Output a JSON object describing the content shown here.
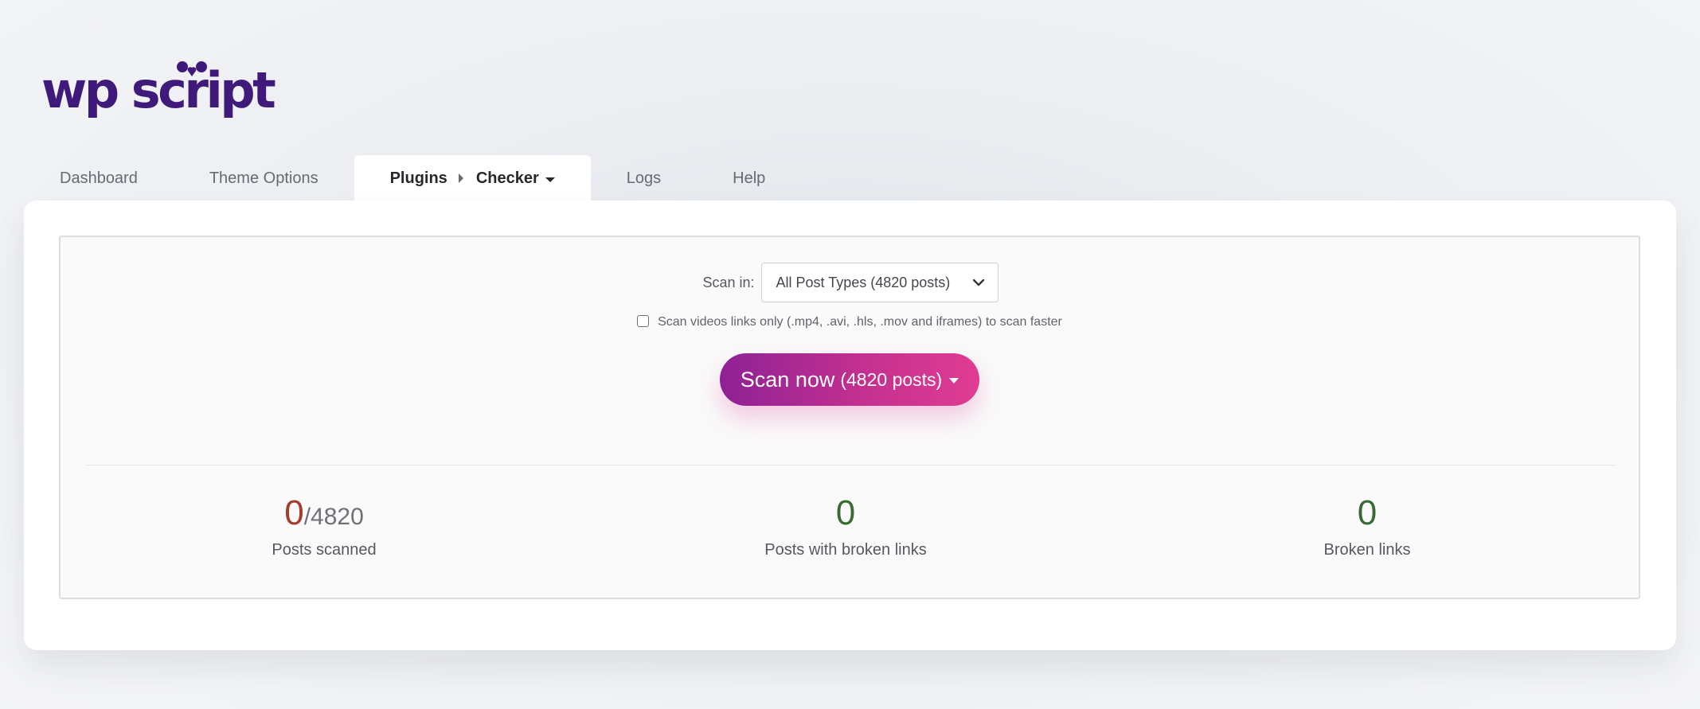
{
  "logo": {
    "text": "wp script"
  },
  "tabs": [
    {
      "label": "Dashboard"
    },
    {
      "label": "Theme Options"
    },
    {
      "label": "Plugins",
      "sub_label": "Checker",
      "active": true
    },
    {
      "label": "Logs"
    },
    {
      "label": "Help"
    }
  ],
  "scan": {
    "label": "Scan in:",
    "select_value": "All Post Types (4820 posts)",
    "checkbox_label": "Scan videos links only (.mp4, .avi, .hls, .mov and iframes) to scan faster",
    "checkbox_checked": false,
    "button_label": "Scan now",
    "button_count": "(4820 posts)"
  },
  "stats": {
    "scanned": {
      "value": "0",
      "total": "/4820",
      "label": "Posts scanned"
    },
    "broken_posts": {
      "value": "0",
      "label": "Posts with broken links"
    },
    "broken_links": {
      "value": "0",
      "label": "Broken links"
    }
  },
  "colors": {
    "brand": "#3f1a7a",
    "button_gradient_start": "#8e2196",
    "button_gradient_end": "#e03c93",
    "scanned_value": "#a83a2c",
    "ok_value": "#3b6b35"
  }
}
